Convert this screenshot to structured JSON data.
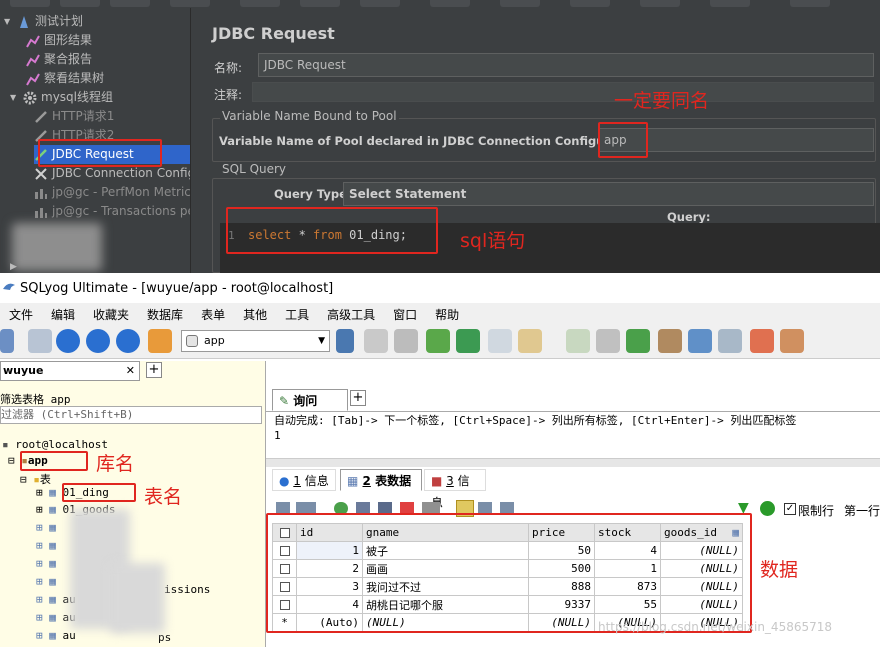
{
  "jmeter": {
    "tree": {
      "items": [
        {
          "label": "测试计划",
          "icon": "test-plan-icon"
        },
        {
          "label": "图形结果",
          "icon": "graph-icon"
        },
        {
          "label": "聚合报告",
          "icon": "graph-icon"
        },
        {
          "label": "察看结果树",
          "icon": "graph-icon"
        },
        {
          "label": "mysql线程组",
          "icon": "gear-icon"
        },
        {
          "label": "HTTP请求1",
          "icon": "pipette-icon"
        },
        {
          "label": "HTTP请求2",
          "icon": "pipette-icon"
        },
        {
          "label": "JDBC Request",
          "icon": "pipette-icon"
        },
        {
          "label": "JDBC Connection Configu",
          "icon": "wrench-icon"
        },
        {
          "label": "jp@gc - PerfMon Metrics",
          "icon": "graph-icon"
        },
        {
          "label": "jp@gc - Transactions pe",
          "icon": "graph-icon"
        }
      ]
    },
    "panel": {
      "title": "JDBC Request",
      "name_label": "名称:",
      "name_value": "JDBC Request",
      "comment_label": "注释:",
      "pool_group_title": "Variable Name Bound to Pool",
      "pool_label": "Variable Name of Pool declared in JDBC Connection Configuration:",
      "pool_value": "app",
      "sql_group_title": "SQL Query",
      "query_type_label": "Query Type:",
      "query_type_value": "Select Statement",
      "query_label": "Query:",
      "code_line_no": "1",
      "code_kw1": "select",
      "code_rest1": " * ",
      "code_kw2": "from",
      "code_table": " 01_ding;"
    },
    "annotations": {
      "same_name": "一定要同名",
      "sql_stmt": "sql语句"
    }
  },
  "sqlyog": {
    "title": "SQLyog Ultimate - [wuyue/app - root@localhost]",
    "menu": [
      "文件",
      "编辑",
      "收藏夹",
      "数据库",
      "表单",
      "其他",
      "工具",
      "高级工具",
      "窗口",
      "帮助"
    ],
    "db_selector": "app",
    "left": {
      "tab": "wuyue",
      "filter_label": "筛选表格",
      "filter_value": "app",
      "filter_placeholder": "过滤器 (Ctrl+Shift+B)",
      "server": "root@localhost",
      "db": "app",
      "tables_folder": "表",
      "table1": "01_ding",
      "table2": "01_goods",
      "partial1": "issions",
      "partial2": "ps",
      "au1": "au",
      "au2": "au",
      "au3": "au"
    },
    "annotations": {
      "db_name": "库名",
      "table_name": "表名",
      "data": "数据"
    },
    "query_tab": "询问",
    "autocomplete": "自动完成: [Tab]-> 下一个标签, [Ctrl+Space]-> 列出所有标签, [Ctrl+Enter]-> 列出匹配标签",
    "editor_line": "1",
    "result_tabs": [
      {
        "num": "1",
        "label": "信息"
      },
      {
        "num": "2",
        "label": "表数据"
      },
      {
        "num": "3",
        "label": "信息"
      }
    ],
    "limit_label": "限制行",
    "first_row_label": "第一行",
    "grid": {
      "columns": [
        "id",
        "gname",
        "price",
        "stock",
        "goods_id"
      ],
      "rows": [
        [
          "1",
          "被子",
          "50",
          "4",
          "(NULL)"
        ],
        [
          "2",
          "画画",
          "500",
          "1",
          "(NULL)"
        ],
        [
          "3",
          "我问过不过",
          "888",
          "873",
          "(NULL)"
        ],
        [
          "4",
          "胡桃日记哪个服",
          "9337",
          "55",
          "(NULL)"
        ]
      ],
      "new_row": [
        "(Auto)",
        "(NULL)",
        "(NULL)",
        "(NULL)",
        "(NULL)"
      ],
      "new_row_marker": "*"
    },
    "watermark": "https://blog.csdn.net/weixin_45865718"
  },
  "colors": {
    "annotation_red": "#e0261f",
    "jmeter_bg": "#3c3f41",
    "selection": "#2f65ca"
  }
}
